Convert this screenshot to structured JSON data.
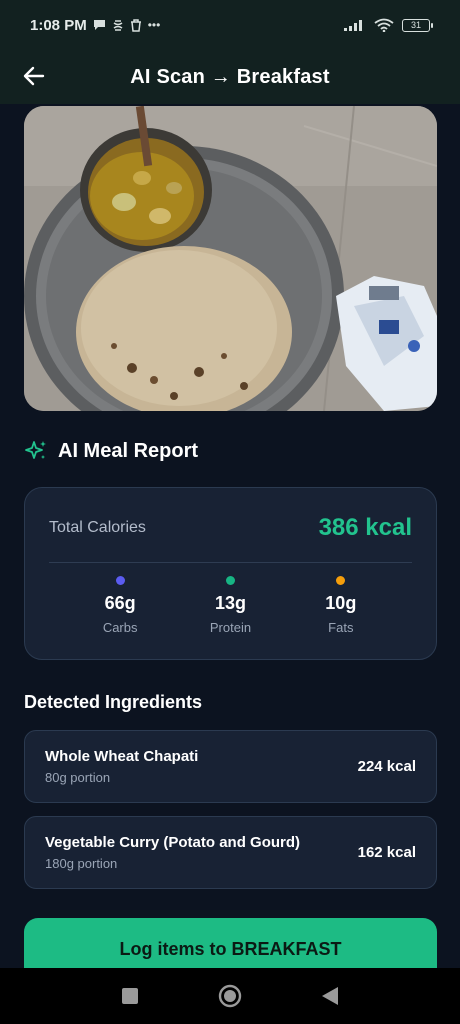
{
  "status_bar": {
    "time": "1:08 PM",
    "battery": "31"
  },
  "header": {
    "title": "AI Scan → Breakfast"
  },
  "report": {
    "title": "AI Meal Report"
  },
  "calories": {
    "label": "Total Calories",
    "value": "386 kcal",
    "macros": [
      {
        "value": "66g",
        "label": "Carbs",
        "color": "#5b5cf0"
      },
      {
        "value": "13g",
        "label": "Protein",
        "color": "#17b584"
      },
      {
        "value": "10g",
        "label": "Fats",
        "color": "#f59e0b"
      }
    ]
  },
  "ingredients": {
    "title": "Detected Ingredients",
    "items": [
      {
        "name": "Whole Wheat Chapati",
        "portion": "80g portion",
        "kcal": "224 kcal"
      },
      {
        "name": "Vegetable Curry (Potato and Gourd)",
        "portion": "180g portion",
        "kcal": "162 kcal"
      }
    ]
  },
  "actions": {
    "log_label": "Log items to BREAKFAST"
  },
  "colors": {
    "accent": "#1dbb84",
    "calorie_text": "#22c38e",
    "background": "#0c1320",
    "card": "#182234"
  }
}
